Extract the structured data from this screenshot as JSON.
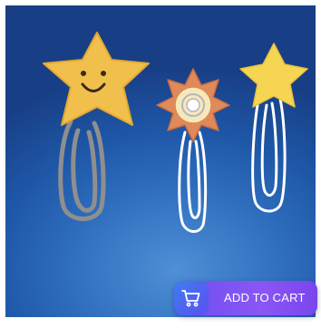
{
  "card": {
    "image_description_icons": [
      "smiley-star-paperclip-icon",
      "sun-paperclip-icon",
      "star-paperclip-icon"
    ],
    "cart_button_label": "ADD TO CART",
    "cart_icon": "shopping-cart-icon"
  },
  "colors": {
    "background": "#1e56a6",
    "button": "#7a50f0",
    "star_yellow": "#f1c04c",
    "sun_orange": "#e08a5b"
  }
}
